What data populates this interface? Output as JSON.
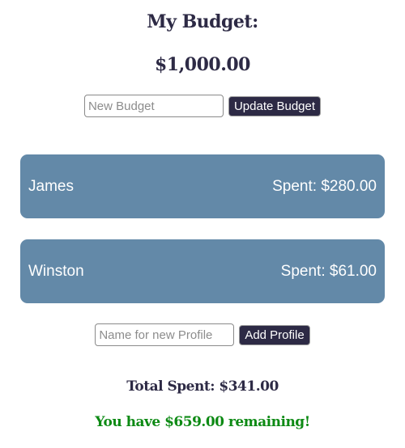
{
  "budget": {
    "title": "My Budget:",
    "amount": "$1,000.00",
    "input_placeholder": "New Budget",
    "update_label": "Update Budget"
  },
  "profiles": [
    {
      "name": "James",
      "spent": "Spent: $280.00"
    },
    {
      "name": "Winston",
      "spent": "Spent: $61.00"
    }
  ],
  "add_profile": {
    "input_placeholder": "Name for new Profile",
    "button_label": "Add Profile"
  },
  "summary": {
    "total_spent": "Total Spent: $341.00",
    "remaining": "You have $659.00 remaining!"
  },
  "colors": {
    "primary": "#2d2a45",
    "card": "#6389a8",
    "remaining": "#0d8a14"
  }
}
